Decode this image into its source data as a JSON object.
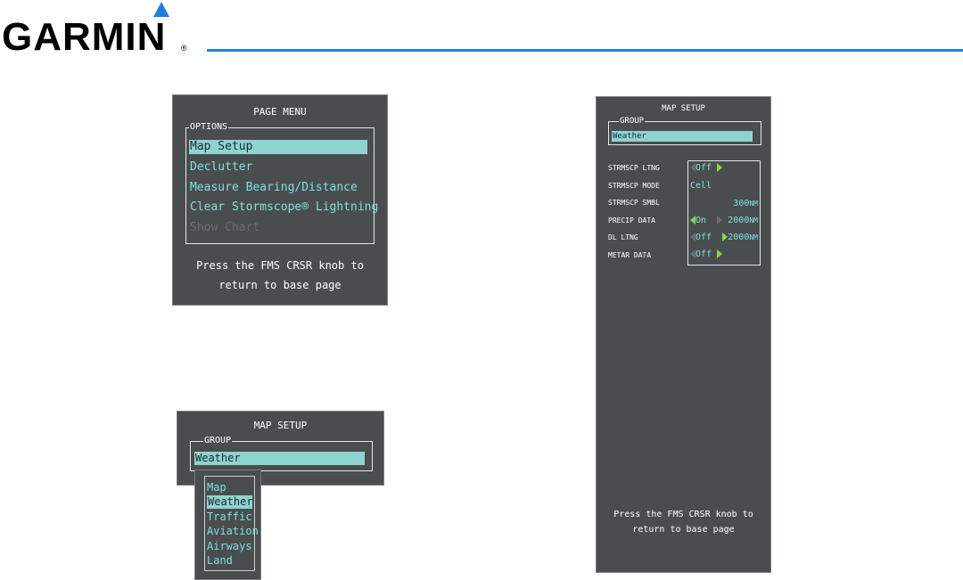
{
  "brand": {
    "name": "GARMIN",
    "registered": "®"
  },
  "page_menu": {
    "title": "PAGE MENU",
    "group_label": "OPTIONS",
    "items": [
      {
        "label": "Map Setup",
        "state": "selected"
      },
      {
        "label": "Declutter",
        "state": "enabled"
      },
      {
        "label": "Measure Bearing/Distance",
        "state": "enabled"
      },
      {
        "label": "Clear Stormscope® Lightning",
        "state": "enabled"
      },
      {
        "label": "Show Chart",
        "state": "disabled"
      }
    ],
    "footer_line1": "Press the FMS CRSR knob to",
    "footer_line2": "return to base page"
  },
  "map_setup_list": {
    "title": "MAP SETUP",
    "group_label": "GROUP",
    "group_value": "Weather",
    "options": [
      {
        "label": "Map",
        "selected": false
      },
      {
        "label": "Weather",
        "selected": true
      },
      {
        "label": "Traffic",
        "selected": false
      },
      {
        "label": "Aviation",
        "selected": false
      },
      {
        "label": "Airways",
        "selected": false
      },
      {
        "label": "Land",
        "selected": false
      }
    ]
  },
  "map_setup_weather": {
    "title": "MAP SETUP",
    "group_label": "GROUP",
    "group_value": "Weather",
    "rows": [
      {
        "label": "STRMSCP LTNG",
        "value": "Off",
        "range": "",
        "unit": ""
      },
      {
        "label": "STRMSCP MODE",
        "value": "Cell",
        "range": "",
        "unit": ""
      },
      {
        "label": "STRMSCP SMBL",
        "value": "",
        "range": "300",
        "unit": "NM"
      },
      {
        "label": "PRECIP DATA",
        "value": "On",
        "range": "2000",
        "unit": "NM"
      },
      {
        "label": "DL LTNG",
        "value": "Off",
        "range": "2000",
        "unit": "NM"
      },
      {
        "label": "METAR DATA",
        "value": "Off",
        "range": "",
        "unit": ""
      }
    ],
    "footer_line1": "Press the FMS CRSR knob to",
    "footer_line2": "return to base page"
  },
  "colors": {
    "panel_bg": "#4a4d4f",
    "cyan_text": "#7fe0de",
    "selection_bg": "#8fd3d1",
    "arrow_green": "#7ddc4a",
    "rule_blue": "#1f7fd6"
  }
}
